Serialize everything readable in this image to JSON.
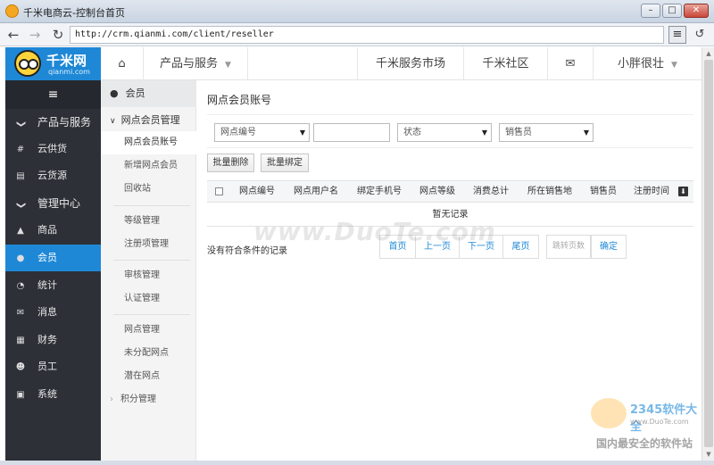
{
  "window": {
    "title": "千米电商云-控制台首页",
    "url": "http://crm.qianmi.com/client/reseller"
  },
  "logo": {
    "brand": "千米网",
    "sub": "qianmi.com"
  },
  "topnav": {
    "product": "产品与服务",
    "market": "千米服务市场",
    "community": "千米社区",
    "user": "小胖很壮"
  },
  "sidebar": {
    "items": [
      {
        "label": "产品与服务",
        "icon": "chevron-down-icon",
        "glyph": "❯"
      },
      {
        "label": "云供货",
        "icon": "supply-icon",
        "glyph": "#"
      },
      {
        "label": "云货源",
        "icon": "source-icon",
        "glyph": "▤"
      },
      {
        "label": "管理中心",
        "icon": "chevron-down-icon",
        "glyph": "❯"
      },
      {
        "label": "商品",
        "icon": "product-icon",
        "glyph": "▲"
      },
      {
        "label": "会员",
        "icon": "member-icon",
        "glyph": "●"
      },
      {
        "label": "统计",
        "icon": "stats-icon",
        "glyph": "◔"
      },
      {
        "label": "消息",
        "icon": "message-icon",
        "glyph": "✉"
      },
      {
        "label": "财务",
        "icon": "finance-icon",
        "glyph": "▦"
      },
      {
        "label": "员工",
        "icon": "staff-icon",
        "glyph": "☻"
      },
      {
        "label": "系统",
        "icon": "system-icon",
        "glyph": "▣"
      }
    ]
  },
  "submenu": {
    "header": "会员",
    "items": [
      "网点会员管理",
      "网点会员账号",
      "新增网点会员",
      "回收站",
      "等级管理",
      "注册项管理",
      "审核管理",
      "认证管理",
      "网点管理",
      "未分配网点",
      "潜在网点",
      "积分管理"
    ]
  },
  "main": {
    "title": "网点会员账号",
    "filters": {
      "outlet_select": "网点编号",
      "status_select": "状态",
      "sales_select": "销售员"
    },
    "buttons": {
      "batch_delete": "批量删除",
      "batch_bind": "批量绑定"
    },
    "columns": [
      "网点编号",
      "网点用户名",
      "绑定手机号",
      "网点等级",
      "消费总计",
      "所在销售地",
      "销售员",
      "注册时间"
    ],
    "empty": "暂无记录",
    "no_records": "没有符合条件的记录",
    "pager": {
      "first": "首页",
      "prev": "上一页",
      "next": "下一页",
      "last": "尾页",
      "jump_placeholder": "跳转页数",
      "ok": "确定"
    }
  },
  "watermark": {
    "site": "www.DuoTe.com",
    "brand": "2345软件大全",
    "url": "www.DuoTe.com",
    "slogan": "国内最安全的软件站"
  },
  "colors": {
    "accent": "#1e88d6",
    "sidebar": "#2d3037"
  }
}
